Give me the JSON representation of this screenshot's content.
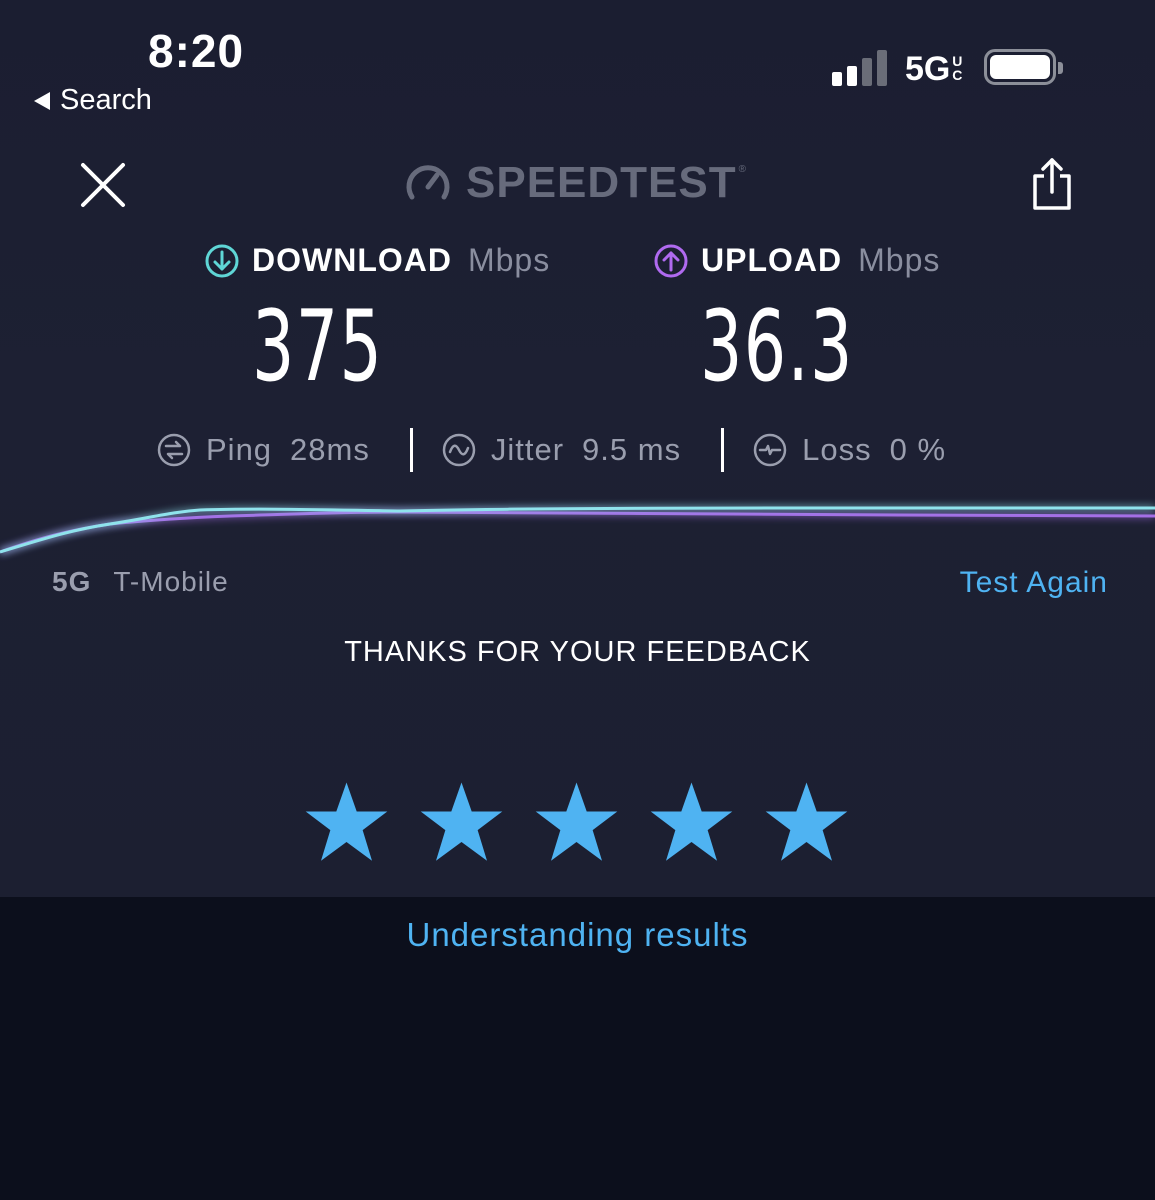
{
  "status_bar": {
    "time": "8:20",
    "back_label": "Search",
    "network": "5G",
    "network_suffix_top": "U",
    "network_suffix_bottom": "C",
    "signal_bars": 4,
    "signal_bars_active": 2
  },
  "header": {
    "logo_text": "SPEEDTEST",
    "logo_tm": "®"
  },
  "download": {
    "label": "DOWNLOAD",
    "unit": "Mbps",
    "value": "375",
    "color": "#5fd6d6"
  },
  "upload": {
    "label": "UPLOAD",
    "unit": "Mbps",
    "value": "36.3",
    "color": "#b06af0"
  },
  "stats": {
    "ping_label": "Ping",
    "ping_value": "28",
    "ping_unit": "ms",
    "jitter_label": "Jitter",
    "jitter_value": "9.5",
    "jitter_unit": "ms",
    "loss_label": "Loss",
    "loss_value": "0",
    "loss_unit": "%"
  },
  "connection": {
    "generation": "5G",
    "carrier": "T-Mobile",
    "test_again": "Test Again"
  },
  "feedback": {
    "title": "THANKS FOR YOUR FEEDBACK",
    "rating": 5,
    "max_rating": 5,
    "star_color": "#4fb3f2"
  },
  "footer": {
    "understanding_link": "Understanding results"
  }
}
